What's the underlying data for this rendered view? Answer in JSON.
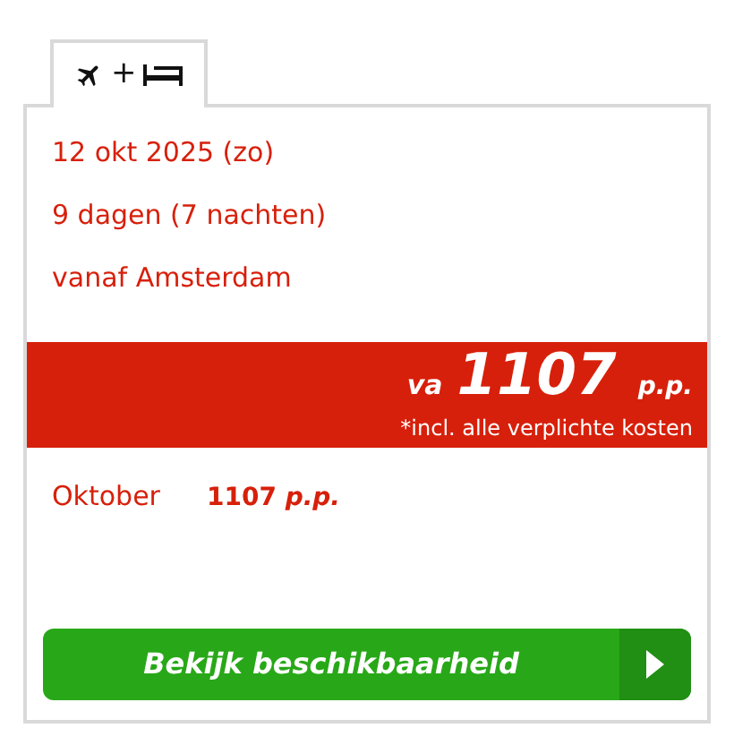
{
  "tabs": [
    {
      "kind": "flight-hotel",
      "label": "+",
      "selected": true
    }
  ],
  "details": [
    "12 okt 2025 (zo)",
    "9 dagen (7 nachten)",
    "vanaf Amsterdam"
  ],
  "price_banner": {
    "prefix": "va",
    "amount": "1107",
    "unit": "p.p.",
    "note": "*incl. alle verplichte kosten"
  },
  "months": [
    {
      "month": "Oktober",
      "amount": "1107",
      "unit": "p.p."
    }
  ],
  "cta": {
    "label": "Bekijk beschikbaarheid"
  }
}
